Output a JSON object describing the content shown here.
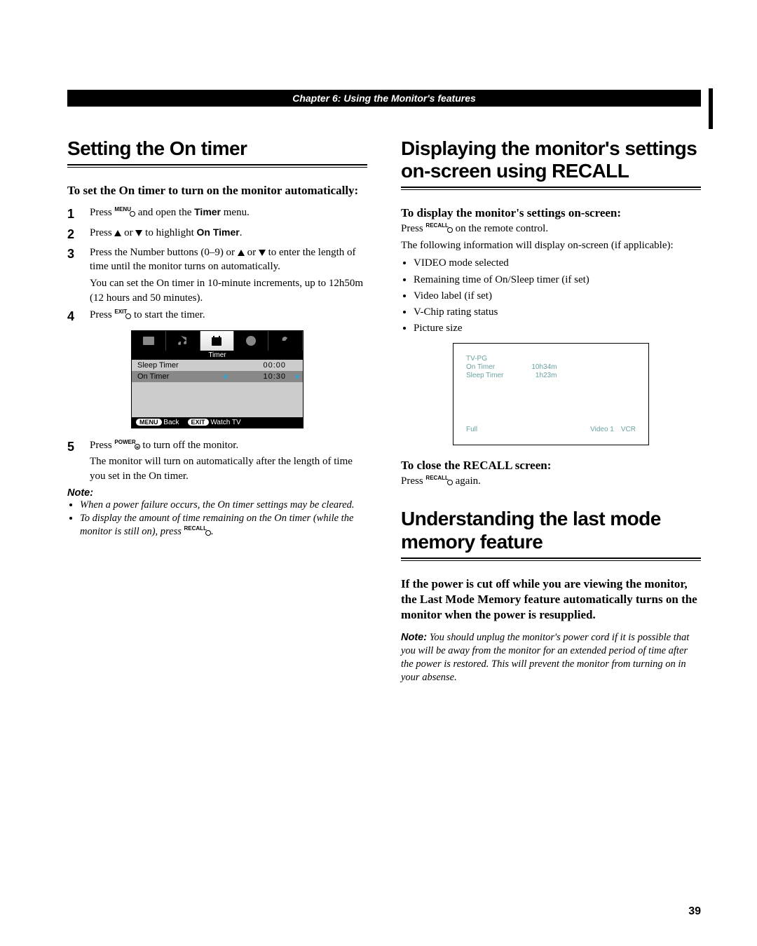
{
  "chapter_banner": "Chapter 6: Using the Monitor's features",
  "left": {
    "title": "Setting the On timer",
    "subhead": "To set the On timer to turn on the monitor automatically:",
    "steps": [
      {
        "num": "1",
        "pre": "Press ",
        "btn": "MENU",
        "post1": " and open the ",
        "bold": "Timer",
        "post2": " menu."
      },
      {
        "num": "2",
        "text_a": "Press ",
        "text_b": " or ",
        "text_c": " to highlight ",
        "bold": "On Timer",
        "text_d": "."
      },
      {
        "num": "3",
        "line1a": "Press the Number buttons (0–9) or ",
        "line1b": " or ",
        "line1c": " to enter the length of time until the monitor turns on automatically.",
        "line2": "You can set the On timer in 10-minute increments, up to 12h50m (12 hours and 50 minutes)."
      },
      {
        "num": "4",
        "pre": "Press ",
        "btn": "EXIT",
        "post": " to start the timer."
      }
    ],
    "osd": {
      "subtitle": "Timer",
      "rows": [
        {
          "label": "Sleep Timer",
          "value": "00:00",
          "sel": false
        },
        {
          "label": "On Timer",
          "value": "10:30",
          "sel": true
        }
      ],
      "footer": [
        {
          "pill": "MENU",
          "label": "Back"
        },
        {
          "pill": "EXIT",
          "label": "Watch TV"
        }
      ]
    },
    "step5": {
      "num": "5",
      "pre": "Press ",
      "btn": "POWER",
      "mid": " to turn off the monitor.",
      "line2": "The monitor will turn on automatically after the length of time you set in the On timer."
    },
    "note_head": "Note:",
    "notes": [
      "When a power failure occurs, the On timer settings may be cleared.",
      {
        "a": "To display the amount of time remaining on the On timer (while the monitor is still on), press ",
        "btn": "RECALL",
        "b": "."
      }
    ]
  },
  "right": {
    "title1": "Displaying the monitor's settings on-screen using RECALL",
    "subhead1": "To display the monitor's settings on-screen:",
    "press_recall_a": "Press ",
    "press_recall_btn": "RECALL",
    "press_recall_b": " on the remote control.",
    "following": "The following information will display on-screen (if applicable):",
    "bullets": [
      "VIDEO mode selected",
      "Remaining time of On/Sleep timer (if set)",
      "Video label (if set)",
      "V-Chip rating status",
      "Picture size"
    ],
    "recall_box": {
      "l1": "TV-PG",
      "l2": "On Timer",
      "l3": "Sleep Timer",
      "r1": "10h34m",
      "r2": "1h23m",
      "bl": "Full",
      "br1": "Video 1",
      "br2": "VCR"
    },
    "close_head": "To close the RECALL screen:",
    "close_a": "Press ",
    "close_btn": "RECALL",
    "close_b": " again.",
    "title2": "Understanding the last mode memory feature",
    "para2": "If the power is cut off while you are viewing the monitor, the Last Mode Memory feature automatically turns on the monitor when the power is resupplied.",
    "note2_label": "Note:",
    "note2": " You should unplug the monitor's power cord if it is possible that you will be away from the monitor for an extended period of time after the power is restored. This will prevent the monitor from turning on in your absense."
  },
  "page_number": "39"
}
